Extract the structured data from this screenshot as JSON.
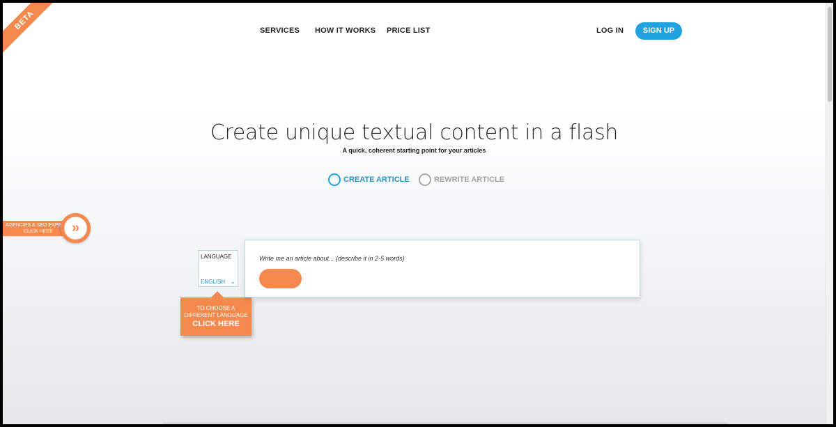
{
  "ribbon": {
    "label": "BETA"
  },
  "nav": {
    "services": "SERVICES",
    "how_it_works": "HOW IT WORKS",
    "price_list": "PRICE LIST",
    "login": "LOG IN",
    "signup": "SIGN UP"
  },
  "hero": {
    "title": "Create unique textual content in a flash",
    "subtitle": "A quick, coherent starting point for your articles"
  },
  "modes": [
    {
      "label": "CREATE ARTICLE",
      "selected": true
    },
    {
      "label": "REWRITE ARTICLE",
      "selected": false
    }
  ],
  "agency": {
    "line1": "AGENCIES & SEO EXPERTS",
    "line2": "CLICK HERE",
    "icon": "double-chevron-right-icon"
  },
  "language": {
    "label": "LANGUAGE",
    "value": "ENGLISH",
    "icon": "chevron-down-icon"
  },
  "tooltip": {
    "line1": "TO CHOOSE A",
    "line2": "DIFFERENT LANGUAGE",
    "cta": "CLICK HERE"
  },
  "article": {
    "placeholder": "Write me an article about... (describe it in 2-5 words)",
    "value": ""
  },
  "colors": {
    "accent_orange": "#f5894d",
    "accent_blue": "#1fa2de"
  }
}
